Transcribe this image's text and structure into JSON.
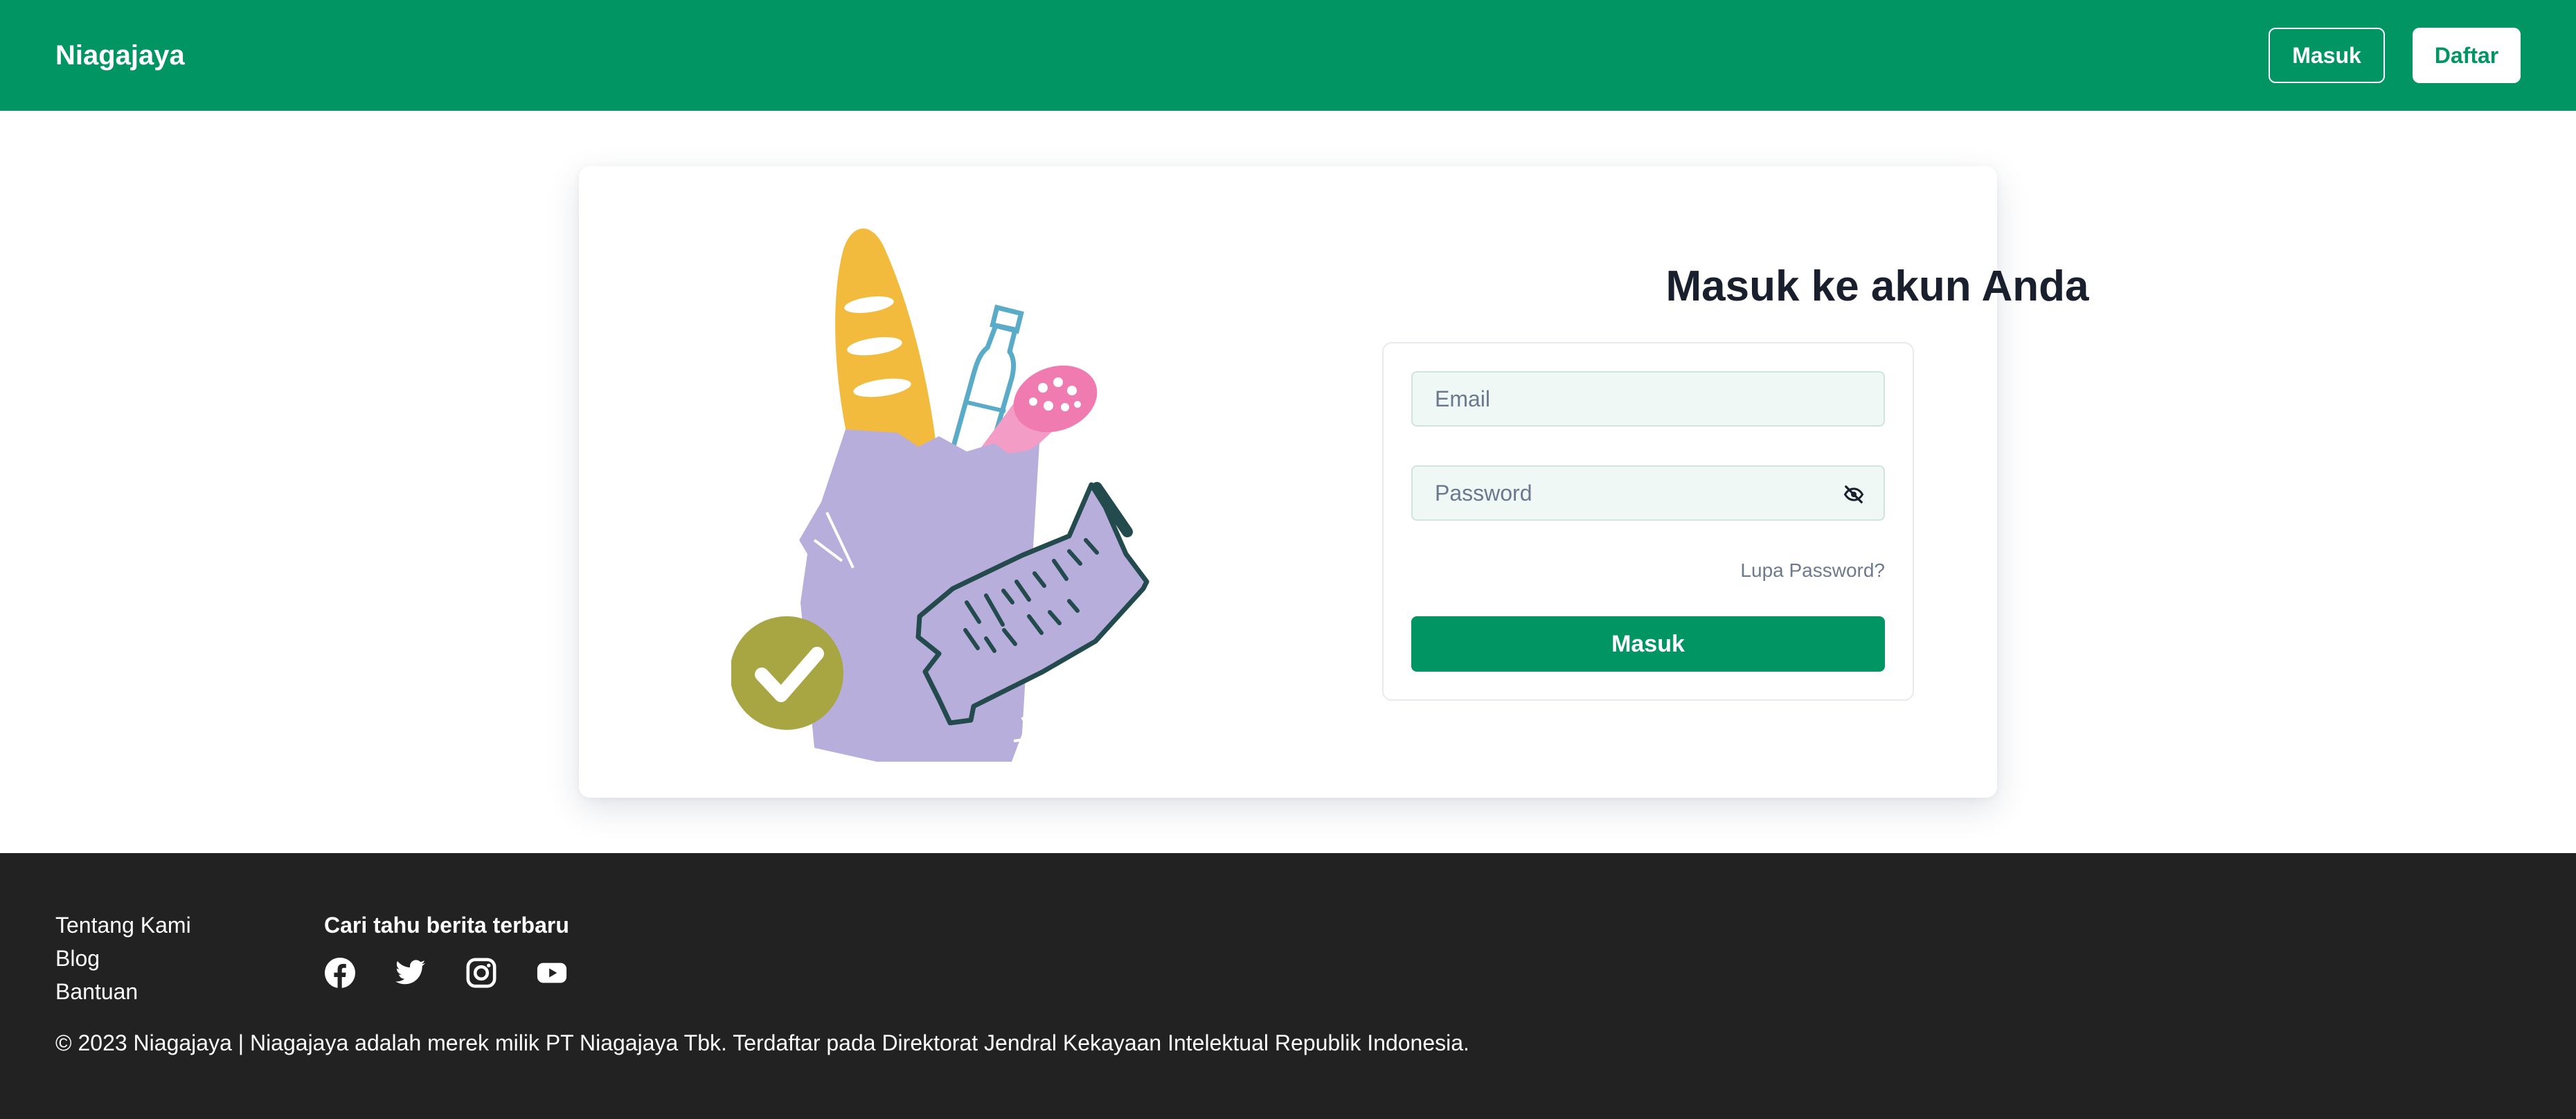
{
  "header": {
    "brand": "Niagajaya",
    "login_label": "Masuk",
    "register_label": "Daftar"
  },
  "login": {
    "title": "Masuk ke akun Anda",
    "email_placeholder": "Email",
    "password_placeholder": "Password",
    "forgot_label": "Lupa Password?",
    "submit_label": "Masuk"
  },
  "footer": {
    "links": [
      "Tentang Kami",
      "Blog",
      "Bantuan"
    ],
    "social_title": "Cari tahu berita terbaru",
    "social_icons": [
      "facebook-icon",
      "twitter-icon",
      "instagram-icon",
      "youtube-icon"
    ],
    "copyright": "© 2023 Niagajaya | Niagajaya adalah merek milik PT Niagajaya Tbk. Terdaftar pada Direktorat Jendral Kekayaan Intelektual Republik Indonesia."
  },
  "colors": {
    "brand_green": "#009562",
    "footer_bg": "#222222",
    "input_bg": "#eff8f4"
  }
}
